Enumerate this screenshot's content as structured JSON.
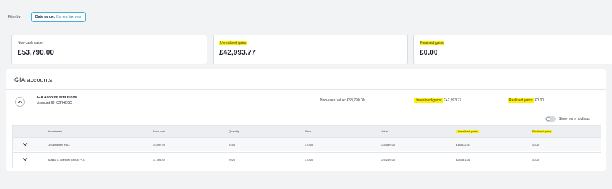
{
  "filter": {
    "label": "Filter by:",
    "chip_key": "Date range:",
    "chip_value": "Current tax year"
  },
  "summary": [
    {
      "label": "Non-cash value",
      "value": "£53,790.00",
      "highlight": false
    },
    {
      "label": "Unrealised gains",
      "value": "£42,993.77",
      "highlight": true
    },
    {
      "label": "Realised gains",
      "value": "£0.00",
      "highlight": true
    }
  ],
  "gia": {
    "title": "GIA accounts",
    "account": {
      "name": "GIA Account with funds",
      "id": "Account ID: 02FHG9C",
      "non_cash_label": "Non-cash value:",
      "non_cash_value": "£53,790.00",
      "unrealised_label": "Unrealised gains:",
      "unrealised_value": "£42,993.77",
      "realised_label": "Realised gains:",
      "realised_value": "£0.00"
    },
    "toggle_label": "Show zero holdings",
    "columns": [
      "Investment",
      "Book cost",
      "Quantity",
      "Price",
      "Value",
      "Unrealised gains",
      "Realised gains"
    ],
    "rows": [
      {
        "investment": "J Sainsbury PLC",
        "book_cost": "£5,997.59",
        "quantity": "2453",
        "price": "£10.00",
        "value": "£24,530.00",
        "unrealised": "£18,532.41",
        "realised": "£0.00"
      },
      {
        "investment": "Marks & Spencer Group PLC",
        "book_cost": "£4,798.64",
        "quantity": "2926",
        "price": "£10.00",
        "value": "£29,260.00",
        "unrealised": "£24,461.36",
        "realised": "£0.00"
      }
    ]
  },
  "colors": {
    "highlight": "#fff200",
    "accent": "#45b0d6"
  }
}
